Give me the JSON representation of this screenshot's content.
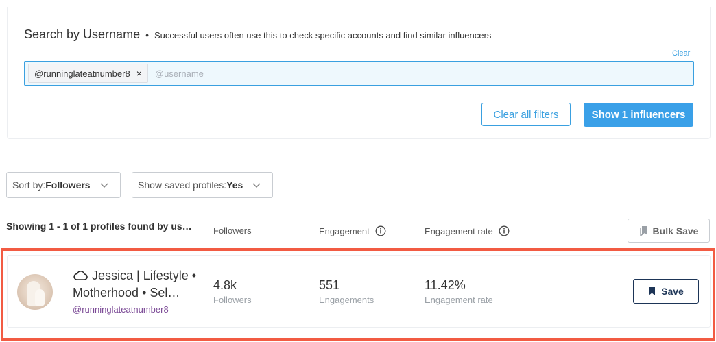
{
  "search": {
    "title": "Search by Username",
    "separator": "•",
    "description": "Successful users often use this to check specific accounts and find similar influencers",
    "clear_label": "Clear",
    "chip_value": "@runninglateatnumber8",
    "chip_remove": "×",
    "placeholder": "@username"
  },
  "filters": {
    "clear_all_label": "Clear all filters",
    "show_label": "Show 1 influencers"
  },
  "sort": {
    "prefix": "Sort by: ",
    "value": "Followers"
  },
  "saved_profiles": {
    "prefix": "Show saved profiles: ",
    "value": "Yes"
  },
  "list": {
    "summary": "Showing 1 - 1 of 1 profiles found by us…",
    "columns": {
      "followers": "Followers",
      "engagement": "Engagement",
      "engagement_rate": "Engagement rate"
    },
    "bulk_save_label": "Bulk Save"
  },
  "profile": {
    "name": "Jessica | Lifestyle • Motherhood • Sel…",
    "handle": "@runninglateatnumber8",
    "followers_value": "4.8k",
    "followers_label": "Followers",
    "engagements_value": "551",
    "engagements_label": "Engagements",
    "engagement_rate_value": "11.42%",
    "engagement_rate_label": "Engagement rate",
    "save_label": "Save"
  },
  "colors": {
    "accent": "#3aa0e8",
    "highlight": "#f25b43",
    "navy": "#1d3557",
    "handle": "#7b4a96"
  }
}
